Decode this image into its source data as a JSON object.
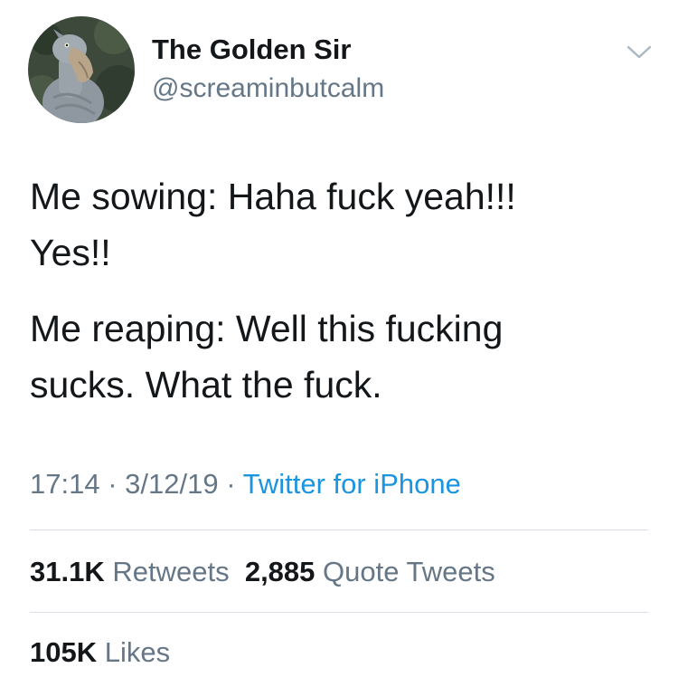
{
  "user": {
    "display_name": "The Golden Sir",
    "handle": "@screaminbutcalm",
    "avatar_icon": "shoebill-bird-avatar"
  },
  "tweet": {
    "paragraphs": [
      "Me sowing: Haha fuck yeah!!!\nYes!!",
      "Me reaping: Well this fucking\nsucks. What the fuck."
    ],
    "time": "17:14",
    "date": "3/12/19",
    "separator": "·",
    "source": "Twitter for iPhone"
  },
  "stats": {
    "retweets_count": "31.1K",
    "retweets_label": "Retweets",
    "quotes_count": "2,885",
    "quotes_label": "Quote Tweets",
    "likes_count": "105K",
    "likes_label": "Likes"
  },
  "colors": {
    "text_primary": "#14171a",
    "text_secondary": "#657786",
    "link_blue": "#1b95e0",
    "divider": "#d8dee3"
  },
  "icons": {
    "more_menu": "chevron-down-icon"
  }
}
